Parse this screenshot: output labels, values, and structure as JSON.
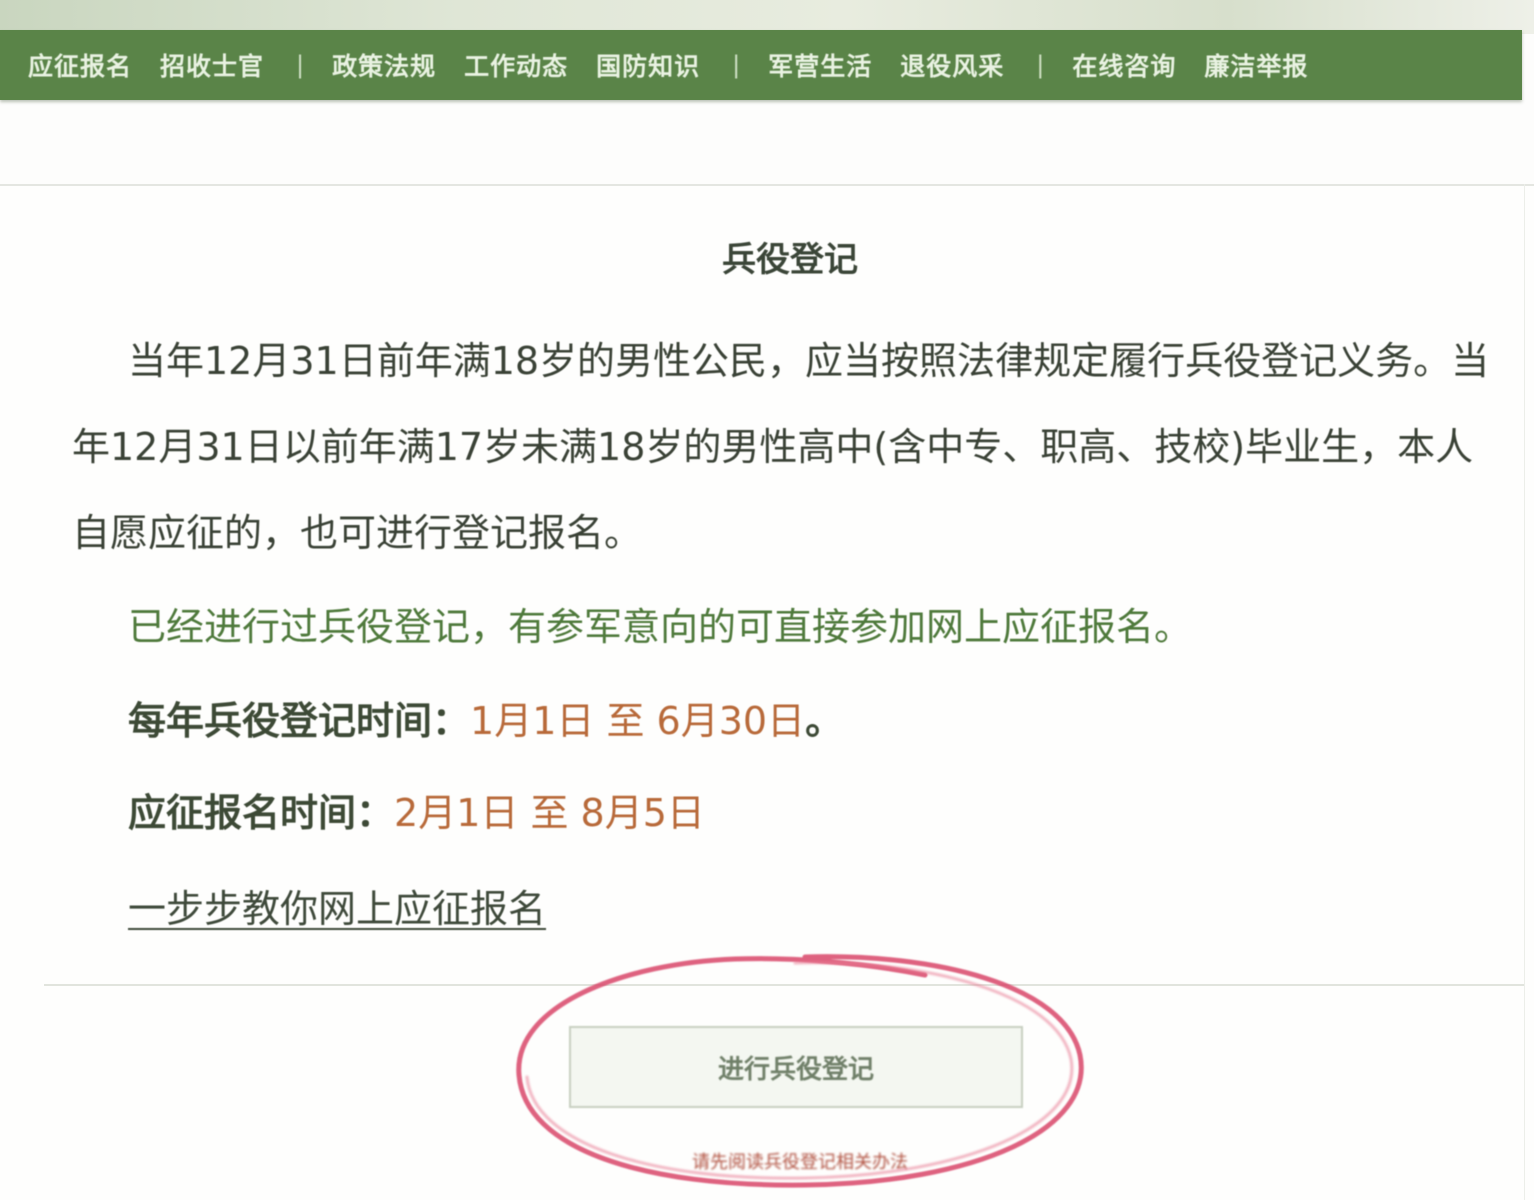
{
  "nav": {
    "items": [
      {
        "label": "应征报名"
      },
      {
        "label": "招收士官"
      },
      {
        "sep": "|"
      },
      {
        "label": "政策法规"
      },
      {
        "label": "工作动态"
      },
      {
        "label": "国防知识"
      },
      {
        "sep": "|"
      },
      {
        "label": "军营生活"
      },
      {
        "label": "退役风采"
      },
      {
        "sep": "|"
      },
      {
        "label": "在线咨询"
      },
      {
        "label": "廉洁举报"
      }
    ]
  },
  "section": {
    "title": "兵役登记",
    "paragraph1": "当年12月31日前年满18岁的男性公民，应当按照法律规定履行兵役登记义务。当年12月31日以前年满17岁未满18岁的男性高中(含中专、职高、技校)毕业生，本人自愿应征的，也可进行登记报名。",
    "paragraph2": "已经进行过兵役登记，有参军意向的可直接参加网上应征报名。",
    "registration_time": {
      "label": "每年兵役登记时间：",
      "value": "1月1日 至 6月30日",
      "suffix": "。"
    },
    "application_time": {
      "label": "应征报名时间：",
      "value": "2月1日 至 8月5日"
    },
    "guide_link": "一步步教你网上应征报名"
  },
  "actions": {
    "register_button": "进行兵役登记",
    "note": "请先阅读兵役登记相关办法"
  },
  "colors": {
    "nav_bg": "#5a8448",
    "accent_value": "#b86a3a",
    "highlight_text": "#4f7a3c",
    "annotation_circle": "#d9476a"
  }
}
